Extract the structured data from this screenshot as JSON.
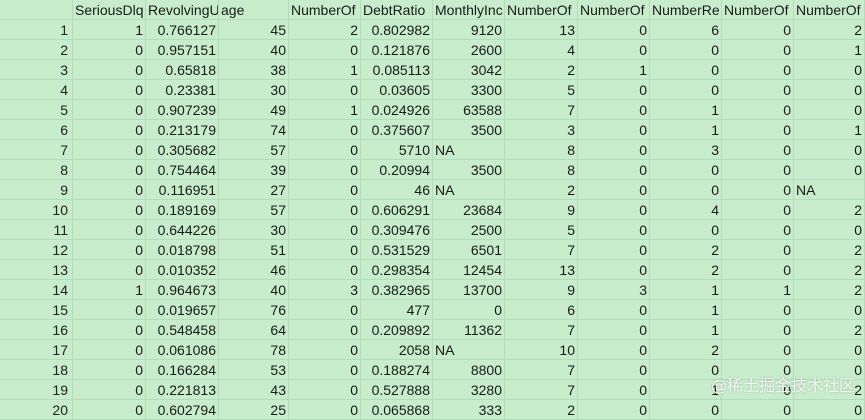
{
  "headers": [
    "",
    "SeriousDlq",
    "RevolvingU",
    "age",
    "NumberOf",
    "DebtRatio",
    "MonthlyInc",
    "NumberOf",
    "NumberOf",
    "NumberRe",
    "NumberOf",
    "NumberOf"
  ],
  "rows": [
    [
      "1",
      "1",
      "0.766127",
      "45",
      "2",
      "0.802982",
      "9120",
      "13",
      "0",
      "6",
      "0",
      "2"
    ],
    [
      "2",
      "0",
      "0.957151",
      "40",
      "0",
      "0.121876",
      "2600",
      "4",
      "0",
      "0",
      "0",
      "1"
    ],
    [
      "3",
      "0",
      "0.65818",
      "38",
      "1",
      "0.085113",
      "3042",
      "2",
      "1",
      "0",
      "0",
      "0"
    ],
    [
      "4",
      "0",
      "0.23381",
      "30",
      "0",
      "0.03605",
      "3300",
      "5",
      "0",
      "0",
      "0",
      "0"
    ],
    [
      "5",
      "0",
      "0.907239",
      "49",
      "1",
      "0.024926",
      "63588",
      "7",
      "0",
      "1",
      "0",
      "0"
    ],
    [
      "6",
      "0",
      "0.213179",
      "74",
      "0",
      "0.375607",
      "3500",
      "3",
      "0",
      "1",
      "0",
      "1"
    ],
    [
      "7",
      "0",
      "0.305682",
      "57",
      "0",
      "5710",
      "NA",
      "8",
      "0",
      "3",
      "0",
      "0"
    ],
    [
      "8",
      "0",
      "0.754464",
      "39",
      "0",
      "0.20994",
      "3500",
      "8",
      "0",
      "0",
      "0",
      "0"
    ],
    [
      "9",
      "0",
      "0.116951",
      "27",
      "0",
      "46",
      "NA",
      "2",
      "0",
      "0",
      "0",
      "NA"
    ],
    [
      "10",
      "0",
      "0.189169",
      "57",
      "0",
      "0.606291",
      "23684",
      "9",
      "0",
      "4",
      "0",
      "2"
    ],
    [
      "11",
      "0",
      "0.644226",
      "30",
      "0",
      "0.309476",
      "2500",
      "5",
      "0",
      "0",
      "0",
      "0"
    ],
    [
      "12",
      "0",
      "0.018798",
      "51",
      "0",
      "0.531529",
      "6501",
      "7",
      "0",
      "2",
      "0",
      "2"
    ],
    [
      "13",
      "0",
      "0.010352",
      "46",
      "0",
      "0.298354",
      "12454",
      "13",
      "0",
      "2",
      "0",
      "2"
    ],
    [
      "14",
      "1",
      "0.964673",
      "40",
      "3",
      "0.382965",
      "13700",
      "9",
      "3",
      "1",
      "1",
      "2"
    ],
    [
      "15",
      "0",
      "0.019657",
      "76",
      "0",
      "477",
      "0",
      "6",
      "0",
      "1",
      "0",
      "0"
    ],
    [
      "16",
      "0",
      "0.548458",
      "64",
      "0",
      "0.209892",
      "11362",
      "7",
      "0",
      "1",
      "0",
      "2"
    ],
    [
      "17",
      "0",
      "0.061086",
      "78",
      "0",
      "2058",
      "NA",
      "10",
      "0",
      "2",
      "0",
      "0"
    ],
    [
      "18",
      "0",
      "0.166284",
      "53",
      "0",
      "0.188274",
      "8800",
      "7",
      "0",
      "0",
      "0",
      "0"
    ],
    [
      "19",
      "0",
      "0.221813",
      "43",
      "0",
      "0.527888",
      "3280",
      "7",
      "0",
      "1",
      "0",
      "2"
    ],
    [
      "20",
      "0",
      "0.602794",
      "25",
      "0",
      "0.065868",
      "333",
      "2",
      "0",
      "0",
      "0",
      "0"
    ]
  ],
  "watermark": "@稀土掘金技术社区",
  "colors": {
    "background": "#c7edcc",
    "gridline": "#b4dbbb"
  }
}
